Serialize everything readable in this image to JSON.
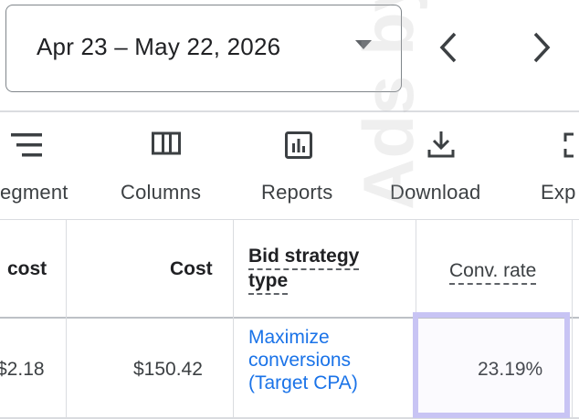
{
  "date_range": {
    "label": "Apr 23 – May 22, 2026"
  },
  "toolbar": {
    "segment_label": "egment",
    "columns_label": "Columns",
    "reports_label": "Reports",
    "download_label": "Download",
    "expand_label": "Exp"
  },
  "table": {
    "headers": {
      "avg_cost": "cost",
      "cost": "Cost",
      "bid_strategy_line1": "Bid strategy",
      "bid_strategy_line2": "type",
      "conv_rate": "Conv. rate"
    },
    "row": {
      "avg_cost": "$2.18",
      "cost": "$150.42",
      "bid_strategy_line1": "Maximize",
      "bid_strategy_line2": "conversions",
      "bid_strategy_line3": "(Target CPA)",
      "conv_rate": "23.19%"
    }
  },
  "watermark": "Ads by 20",
  "colors": {
    "link": "#1a73e8",
    "highlight": "#c8c4f4",
    "border": "#dadce0"
  }
}
